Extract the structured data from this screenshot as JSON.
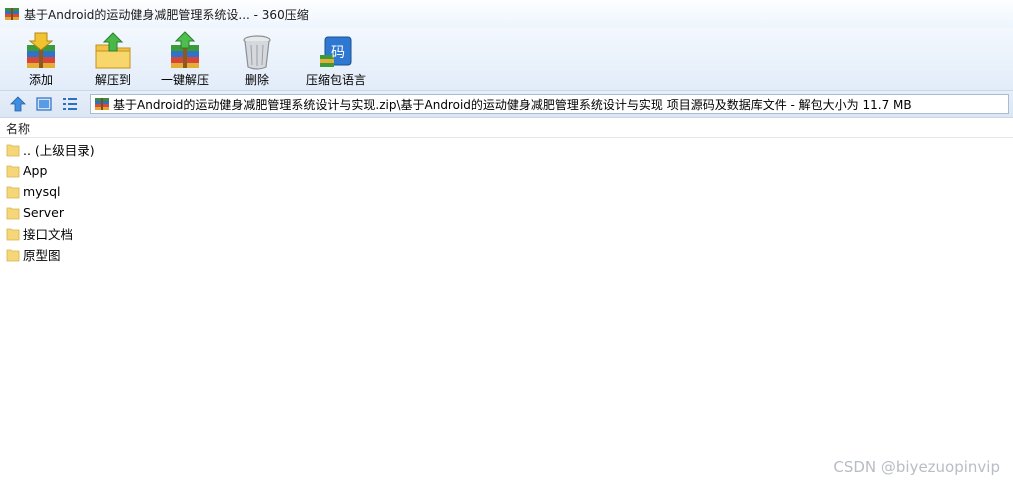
{
  "window": {
    "title": "基于Android的运动健身减肥管理系统设... - 360压缩"
  },
  "toolbar": {
    "buttons": [
      {
        "label": "添加",
        "icon": "add-archive-icon"
      },
      {
        "label": "解压到",
        "icon": "extract-to-icon"
      },
      {
        "label": "一键解压",
        "icon": "one-click-extract-icon"
      },
      {
        "label": "删除",
        "icon": "delete-trash-icon"
      },
      {
        "label": "压缩包语言",
        "icon": "archive-language-icon",
        "glyph": "码"
      }
    ]
  },
  "address": {
    "path": "基于Android的运动健身减肥管理系统设计与实现.zip\\基于Android的运动健身减肥管理系统设计与实现 项目源码及数据库文件 - 解包大小为 11.7 MB"
  },
  "list": {
    "column_name": "名称",
    "items": [
      {
        "label": ".. (上级目录)"
      },
      {
        "label": "App"
      },
      {
        "label": "mysql"
      },
      {
        "label": "Server"
      },
      {
        "label": "接口文档"
      },
      {
        "label": "原型图"
      }
    ]
  },
  "watermark": "CSDN @biyezuopinvip",
  "colors": {
    "toolbar_top": "#f3f8fe",
    "toolbar_bottom": "#e2ecf9",
    "folder": "#f5d77a",
    "address_border": "#a9bcd4"
  }
}
